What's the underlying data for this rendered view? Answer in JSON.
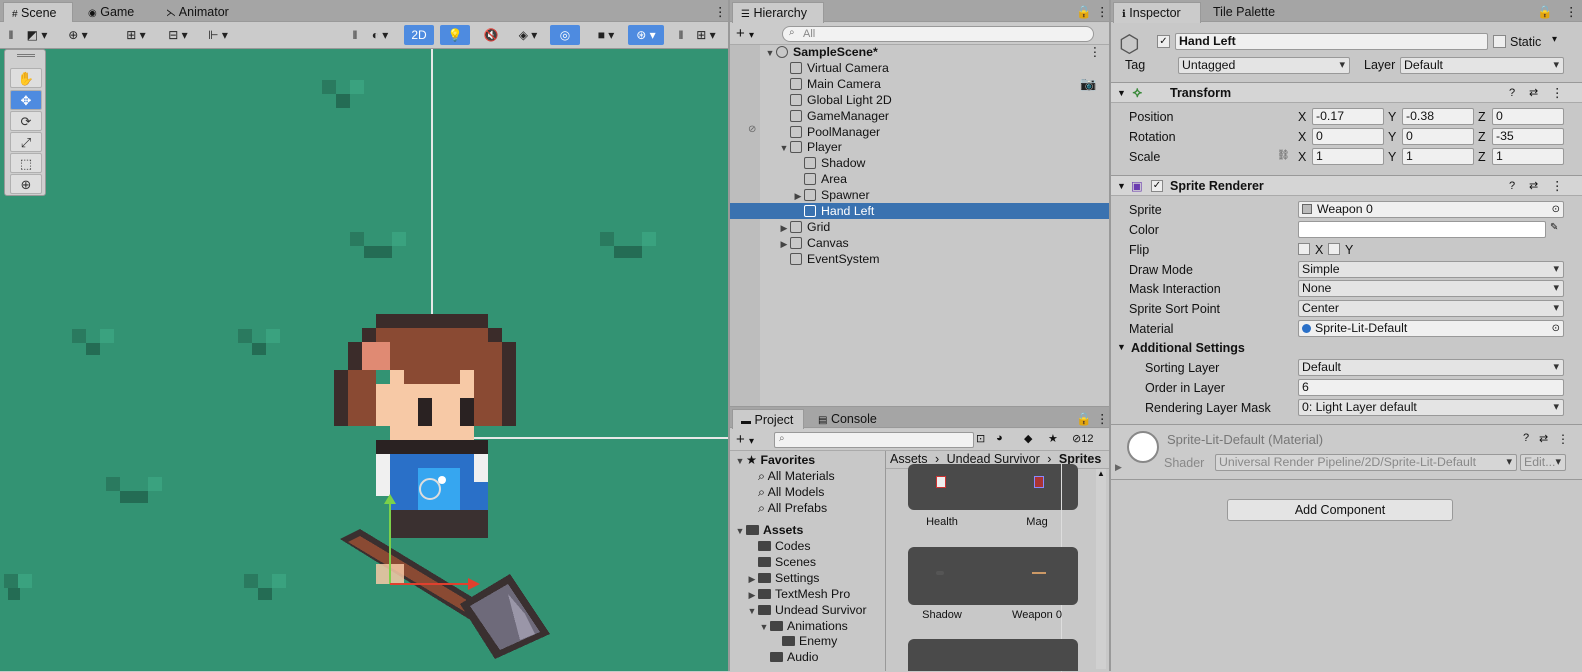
{
  "scene_panel": {
    "tabs": [
      "Scene",
      "Game",
      "Animator"
    ],
    "toolbar": {
      "mode_2d": "2D"
    }
  },
  "hierarchy": {
    "tab": "Hierarchy",
    "search_placeholder": "All",
    "items": [
      {
        "label": "SampleScene*",
        "indent": 0,
        "arrow": "▼",
        "bold": true
      },
      {
        "label": "Virtual Camera",
        "indent": 1,
        "arrow": ""
      },
      {
        "label": "Main Camera",
        "indent": 1,
        "arrow": ""
      },
      {
        "label": "Global Light 2D",
        "indent": 1,
        "arrow": ""
      },
      {
        "label": "GameManager",
        "indent": 1,
        "arrow": ""
      },
      {
        "label": "PoolManager",
        "indent": 1,
        "arrow": ""
      },
      {
        "label": "Player",
        "indent": 1,
        "arrow": "▼"
      },
      {
        "label": "Shadow",
        "indent": 2,
        "arrow": ""
      },
      {
        "label": "Area",
        "indent": 2,
        "arrow": ""
      },
      {
        "label": "Spawner",
        "indent": 2,
        "arrow": "▶"
      },
      {
        "label": "Hand Left",
        "indent": 2,
        "arrow": "",
        "selected": true
      },
      {
        "label": "Grid",
        "indent": 1,
        "arrow": "▶"
      },
      {
        "label": "Canvas",
        "indent": 1,
        "arrow": "▶"
      },
      {
        "label": "EventSystem",
        "indent": 1,
        "arrow": ""
      }
    ]
  },
  "project": {
    "tabs": [
      "Project",
      "Console"
    ],
    "hidden_count": "12",
    "breadcrumb": [
      "Assets",
      "Undead Survivor",
      "Sprites"
    ],
    "tree": [
      {
        "label": "Favorites",
        "indent": 0,
        "arrow": "▼",
        "bold": true,
        "icon": "star"
      },
      {
        "label": "All Materials",
        "indent": 1,
        "arrow": "",
        "icon": "search"
      },
      {
        "label": "All Models",
        "indent": 1,
        "arrow": "",
        "icon": "search"
      },
      {
        "label": "All Prefabs",
        "indent": 1,
        "arrow": "",
        "icon": "search"
      },
      {
        "label": "Assets",
        "indent": 0,
        "arrow": "▼",
        "bold": true,
        "icon": "folder"
      },
      {
        "label": "Codes",
        "indent": 1,
        "arrow": "",
        "icon": "folder"
      },
      {
        "label": "Scenes",
        "indent": 1,
        "arrow": "",
        "icon": "folder"
      },
      {
        "label": "Settings",
        "indent": 1,
        "arrow": "▶",
        "icon": "folder"
      },
      {
        "label": "TextMesh Pro",
        "indent": 1,
        "arrow": "▶",
        "icon": "folder"
      },
      {
        "label": "Undead Survivor",
        "indent": 1,
        "arrow": "▼",
        "icon": "folder"
      },
      {
        "label": "Animations",
        "indent": 2,
        "arrow": "▼",
        "icon": "folder"
      },
      {
        "label": "Enemy",
        "indent": 3,
        "arrow": "",
        "icon": "folder"
      },
      {
        "label": "Audio",
        "indent": 2,
        "arrow": "",
        "icon": "folder"
      }
    ],
    "assets": [
      "Health",
      "Mag",
      "Shadow",
      "Weapon 0"
    ]
  },
  "inspector": {
    "tabs": [
      "Inspector",
      "Tile Palette"
    ],
    "object_name": "Hand Left",
    "static_label": "Static",
    "tag_label": "Tag",
    "tag_value": "Untagged",
    "layer_label": "Layer",
    "layer_value": "Default",
    "transform": {
      "title": "Transform",
      "position_label": "Position",
      "rotation_label": "Rotation",
      "scale_label": "Scale",
      "position": {
        "x": "-0.17",
        "y": "-0.38",
        "z": "0"
      },
      "rotation": {
        "x": "0",
        "y": "0",
        "z": "-35"
      },
      "scale": {
        "x": "1",
        "y": "1",
        "z": "1"
      }
    },
    "sprite_renderer": {
      "title": "Sprite Renderer",
      "sprite_label": "Sprite",
      "sprite_value": "Weapon 0",
      "color_label": "Color",
      "flip_label": "Flip",
      "flip_x": "X",
      "flip_y": "Y",
      "draw_mode_label": "Draw Mode",
      "draw_mode_value": "Simple",
      "mask_label": "Mask Interaction",
      "mask_value": "None",
      "sort_point_label": "Sprite Sort Point",
      "sort_point_value": "Center",
      "material_label": "Material",
      "material_value": "Sprite-Lit-Default",
      "additional_label": "Additional Settings",
      "sorting_layer_label": "Sorting Layer",
      "sorting_layer_value": "Default",
      "order_label": "Order in Layer",
      "order_value": "6",
      "rendering_mask_label": "Rendering Layer Mask",
      "rendering_mask_value": "0: Light Layer default"
    },
    "material": {
      "title": "Sprite-Lit-Default (Material)",
      "shader_label": "Shader",
      "shader_value": "Universal Render Pipeline/2D/Sprite-Lit-Default",
      "edit_label": "Edit..."
    },
    "add_component": "Add Component"
  }
}
